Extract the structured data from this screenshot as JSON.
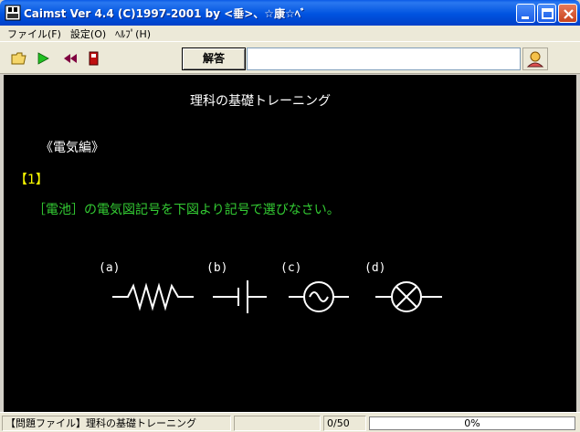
{
  "window": {
    "title": "Caimst Ver 4.4 (C)1997-2001  by <垂>、☆康☆ﾍﾞ"
  },
  "menu": {
    "items": [
      "ファイル(F)",
      "設定(O)",
      "ﾍﾙﾌﾟ(H)"
    ]
  },
  "toolbar": {
    "answer_label": "解答",
    "answer_value": "",
    "icons": [
      "open-folder-icon",
      "play-icon",
      "rewind-icon",
      "stop-icon",
      "hint-icon"
    ]
  },
  "content": {
    "title": "理科の基礎トレーニング",
    "section": "《電気編》",
    "question_number": "【1】",
    "question": "［電池］の電気図記号を下図より記号で選びなさい。",
    "options": [
      {
        "label": "(a)",
        "symbol": "resistor"
      },
      {
        "label": "(b)",
        "symbol": "battery"
      },
      {
        "label": "(c)",
        "symbol": "ac-source"
      },
      {
        "label": "(d)",
        "symbol": "lamp"
      }
    ]
  },
  "status": {
    "file_label": "【問題ファイル】理科の基礎トレーニング",
    "counter": "0/50",
    "progress_text": "0%",
    "progress_value": 0
  },
  "colors": {
    "title_white": "#ffffff",
    "question_number": "#ffff00",
    "question": "#33cc33",
    "progress_fill": "#316ac5"
  }
}
